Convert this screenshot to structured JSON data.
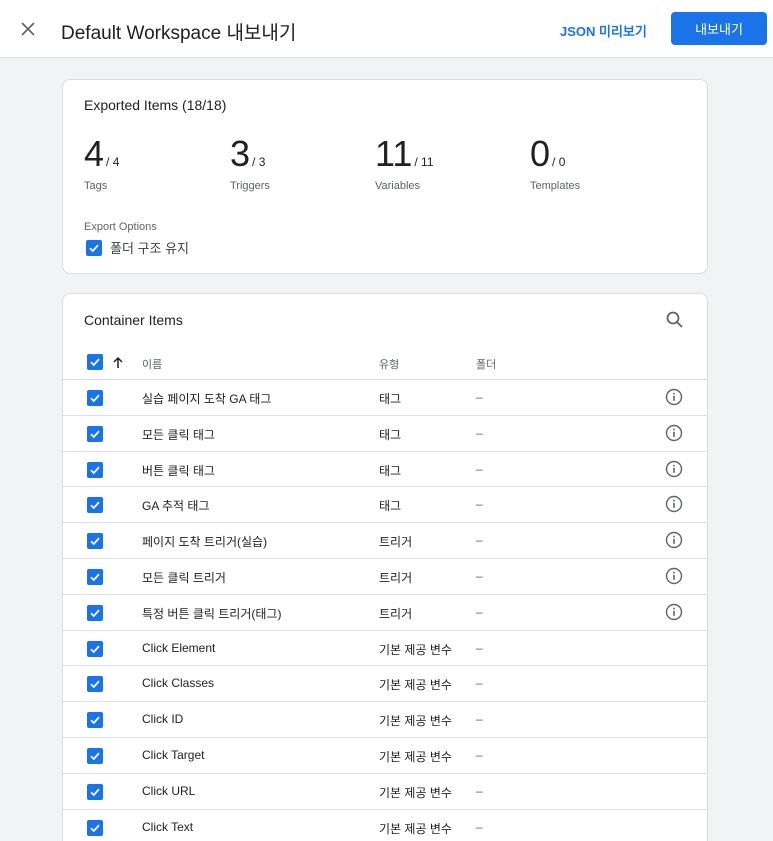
{
  "header": {
    "title": "Default Workspace 내보내기",
    "json_preview_label": "JSON 미리보기",
    "export_label": "내보내기"
  },
  "summary": {
    "title": "Exported Items (18/18)",
    "stats": [
      {
        "count": "4",
        "total": "/ 4",
        "label": "Tags"
      },
      {
        "count": "3",
        "total": "/ 3",
        "label": "Triggers"
      },
      {
        "count": "11",
        "total": "/ 11",
        "label": "Variables"
      },
      {
        "count": "0",
        "total": "/ 0",
        "label": "Templates"
      }
    ],
    "export_options_label": "Export Options",
    "keep_folder_label": "폴더 구조 유지",
    "keep_folder_checked": true
  },
  "items": {
    "title": "Container Items",
    "columns": {
      "name": "이름",
      "type": "유형",
      "folder": "폴더"
    },
    "rows": [
      {
        "name": "실습 페이지 도착 GA 태그",
        "type": "태그",
        "folder": "–"
      },
      {
        "name": "모든 클릭 태그",
        "type": "태그",
        "folder": "–"
      },
      {
        "name": "버튼 클릭 태그",
        "type": "태그",
        "folder": "–"
      },
      {
        "name": "GA 추적 태그",
        "type": "태그",
        "folder": "–"
      },
      {
        "name": "페이지 도착 트리거(실습)",
        "type": "트리거",
        "folder": "–"
      },
      {
        "name": "모든 클릭 트리거",
        "type": "트리거",
        "folder": "–"
      },
      {
        "name": "특정 버튼 클릭 트리거(태그)",
        "type": "트리거",
        "folder": "–"
      },
      {
        "name": "Click Element",
        "type": "기본 제공 변수",
        "folder": "–"
      },
      {
        "name": "Click Classes",
        "type": "기본 제공 변수",
        "folder": "–"
      },
      {
        "name": "Click ID",
        "type": "기본 제공 변수",
        "folder": "–"
      },
      {
        "name": "Click Target",
        "type": "기본 제공 변수",
        "folder": "–"
      },
      {
        "name": "Click URL",
        "type": "기본 제공 변수",
        "folder": "–"
      },
      {
        "name": "Click Text",
        "type": "기본 제공 변수",
        "folder": "–"
      }
    ]
  },
  "colors": {
    "accent": "#1a73e8",
    "background": "#f1f3f4",
    "divider": "#dadce0"
  }
}
